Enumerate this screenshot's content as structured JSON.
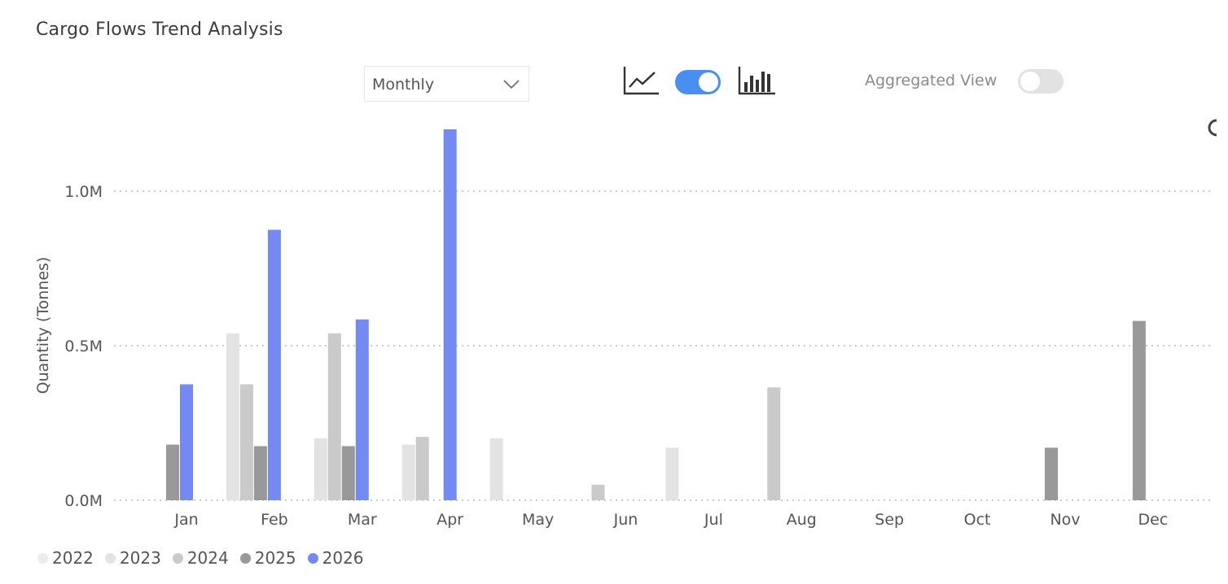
{
  "title": "Cargo Flows Trend Analysis",
  "controls": {
    "period_dropdown": {
      "selected": "Monthly"
    },
    "line_chart_icon": "line-chart-icon",
    "bar_chart_icon": "bar-chart-icon",
    "view_switch_on": true,
    "aggregated_view": {
      "label": "Aggregated View",
      "on": false
    }
  },
  "colors": {
    "2022": "#ececec",
    "2023": "#e3e3e3",
    "2024": "#cacaca",
    "2025": "#999999",
    "2026": "#7589f2",
    "switch_on": "#4a8ff0",
    "switch_off": "#e2e2e2"
  },
  "chart_data": {
    "type": "bar",
    "title": "",
    "xlabel": "",
    "ylabel": "Quantity (Tonnes)",
    "ylim": [
      0,
      1200000
    ],
    "yticks": [
      0,
      500000,
      1000000
    ],
    "ytick_labels": [
      "0.0M",
      "0.5M",
      "1.0M"
    ],
    "grid": true,
    "legend_position": "bottom-left",
    "categories": [
      "Jan",
      "Feb",
      "Mar",
      "Apr",
      "May",
      "Jun",
      "Jul",
      "Aug",
      "Sep",
      "Oct",
      "Nov",
      "Dec"
    ],
    "series": [
      {
        "name": "2022",
        "values": [
          0,
          0,
          0,
          0,
          0,
          0,
          0,
          0,
          0,
          0,
          0,
          0
        ]
      },
      {
        "name": "2023",
        "values": [
          0,
          540000,
          200000,
          180000,
          200000,
          0,
          170000,
          0,
          0,
          0,
          0,
          0
        ]
      },
      {
        "name": "2024",
        "values": [
          0,
          375000,
          540000,
          205000,
          0,
          50000,
          0,
          365000,
          0,
          0,
          0,
          0
        ]
      },
      {
        "name": "2025",
        "values": [
          180000,
          175000,
          175000,
          0,
          0,
          0,
          0,
          0,
          0,
          0,
          170000,
          580000
        ]
      },
      {
        "name": "2026",
        "values": [
          375000,
          875000,
          585000,
          1200000,
          0,
          0,
          0,
          0,
          0,
          0,
          0,
          0
        ]
      }
    ]
  }
}
